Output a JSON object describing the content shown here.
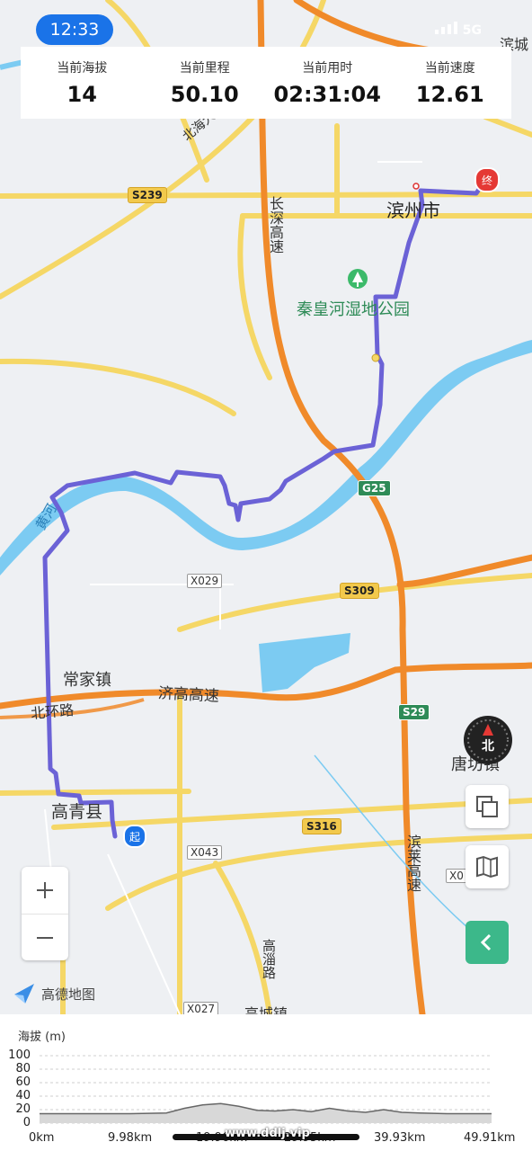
{
  "status_bar": {
    "time": "12:33",
    "network": "5G"
  },
  "stats": [
    {
      "label": "当前海拔",
      "value": "14"
    },
    {
      "label": "当前里程",
      "value": "50.10"
    },
    {
      "label": "当前用时",
      "value": "02:31:04"
    },
    {
      "label": "当前速度",
      "value": "12.61"
    }
  ],
  "map": {
    "places": {
      "binzhou": "滨州市",
      "park": "秦皇河湿地公园",
      "changjia": "常家镇",
      "gaoqing": "高青县",
      "tangfang": "唐坊镇",
      "binzhou_edge": "滨城",
      "beihai": "北海大",
      "gaocheng": "高城镇"
    },
    "roads": {
      "changshen": "长深高速",
      "jigao": "济高高速",
      "beihuan": "北环路",
      "binlai": "滨莱高速",
      "gaozi": "高淄路",
      "yellow_river": "黄河"
    },
    "shields": {
      "s239": "S239",
      "g25": "G25",
      "x029": "X029",
      "s309": "S309",
      "s29": "S29",
      "s316": "S316",
      "x043": "X043",
      "x027": "X027",
      "x0": "X0"
    },
    "markers": {
      "start": "起",
      "end": "终"
    },
    "compass_label": "北",
    "logo_text": "高德地图",
    "colors": {
      "route": "#6b62d6",
      "river": "#7ccbf2",
      "expressway": "#f08a2a",
      "road": "#f5d766"
    }
  },
  "elevation": {
    "title": "海拔 (m)",
    "y_ticks": [
      "100",
      "80",
      "60",
      "40",
      "20",
      "0"
    ],
    "x_ticks": [
      "0km",
      "9.98km",
      "19.96km",
      "29.95km",
      "39.93km",
      "49.91km"
    ]
  },
  "chart_data": {
    "type": "area",
    "title": "海拔 (m)",
    "xlabel": "",
    "ylabel": "海拔 (m)",
    "x_tick_labels": [
      "0km",
      "9.98km",
      "19.96km",
      "29.95km",
      "39.93km",
      "49.91km"
    ],
    "xlim": [
      0,
      49.91
    ],
    "ylim": [
      0,
      100
    ],
    "grid": true,
    "x": [
      0,
      5,
      10,
      14,
      16,
      18,
      20,
      22,
      24,
      26,
      28,
      30,
      32,
      34,
      36,
      38,
      40,
      42,
      45,
      49.91
    ],
    "y": [
      14,
      14,
      14,
      15,
      22,
      27,
      29,
      25,
      19,
      18,
      20,
      17,
      22,
      18,
      16,
      20,
      16,
      15,
      14,
      14
    ]
  },
  "watermark": "www.ddlj.vip"
}
